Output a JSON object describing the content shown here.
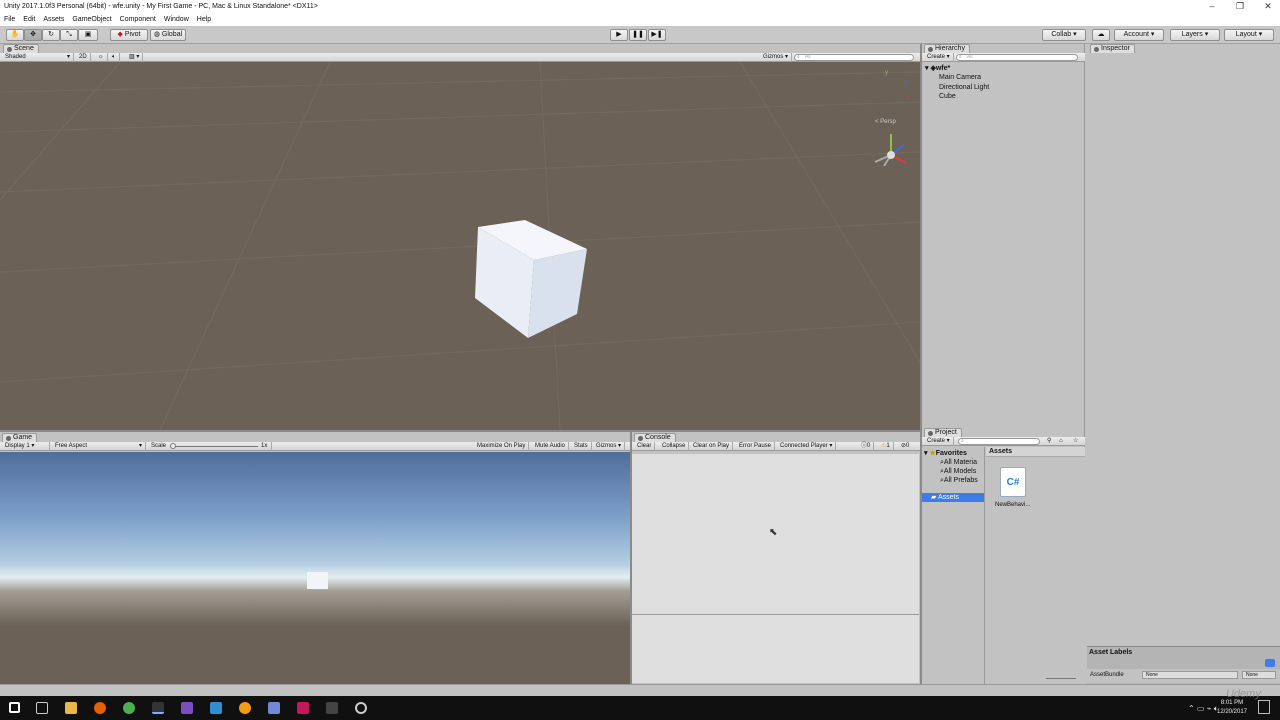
{
  "window": {
    "title": "Unity 2017.1.0f3 Personal (64bit) - wfe.unity - My First Game - PC, Mac & Linux Standalone* <DX11>",
    "minimize": "–",
    "restore": "❐",
    "close": "✕"
  },
  "menu": [
    "File",
    "Edit",
    "Assets",
    "GameObject",
    "Component",
    "Window",
    "Help"
  ],
  "toolbar": {
    "pivot": "Pivot",
    "global": "Global",
    "collab": "Collab ▾",
    "account": "Account",
    "layers": "Layers",
    "layout": "Layout"
  },
  "scene": {
    "tab": "Scene",
    "shading": "Shaded",
    "mode_2d": "2D",
    "gizmos": "Gizmos",
    "search_placeholder": "All",
    "persp": "< Persp",
    "axis_y": "y",
    "axis_x": "x",
    "axis_z": "z"
  },
  "hierarchy": {
    "tab": "Hierarchy",
    "create": "Create",
    "search_placeholder": "All",
    "scene_name": "wfe*",
    "items": [
      "Main Camera",
      "Directional Light",
      "Cube"
    ]
  },
  "inspector": {
    "tab": "Inspector",
    "asset_labels": "Asset Labels",
    "asset_bundle": "AssetBundle",
    "bundle_value": "None",
    "variant_value": "None"
  },
  "game": {
    "tab": "Game",
    "display": "Display 1",
    "aspect": "Free Aspect",
    "scale_label": "Scale",
    "scale_value": "1x",
    "maximize": "Maximize On Play",
    "mute": "Mute Audio",
    "stats": "Stats",
    "gizmos": "Gizmos"
  },
  "console": {
    "tab": "Console",
    "clear": "Clear",
    "collapse": "Collapse",
    "clear_on_play": "Clear on Play",
    "error_pause": "Error Pause",
    "connected_player": "Connected Player",
    "log_count": "0",
    "warn_count": "1",
    "error_count": "0"
  },
  "project": {
    "tab": "Project",
    "create": "Create",
    "favorites": "Favorites",
    "favorites_items": [
      "All Materia",
      "All Models",
      "All Prefabs"
    ],
    "assets_root": "Assets",
    "breadcrumb": "Assets",
    "files": [
      {
        "name": "NewBehavi...",
        "icon_label": "C#"
      }
    ]
  },
  "taskbar": {
    "time": "8:01 PM",
    "date": "12/20/2017"
  },
  "watermark": "Udemy",
  "colors": {
    "scene_bg": "#6b6156",
    "panel_bg": "#c2c2c2",
    "selected": "#3e7de7"
  }
}
